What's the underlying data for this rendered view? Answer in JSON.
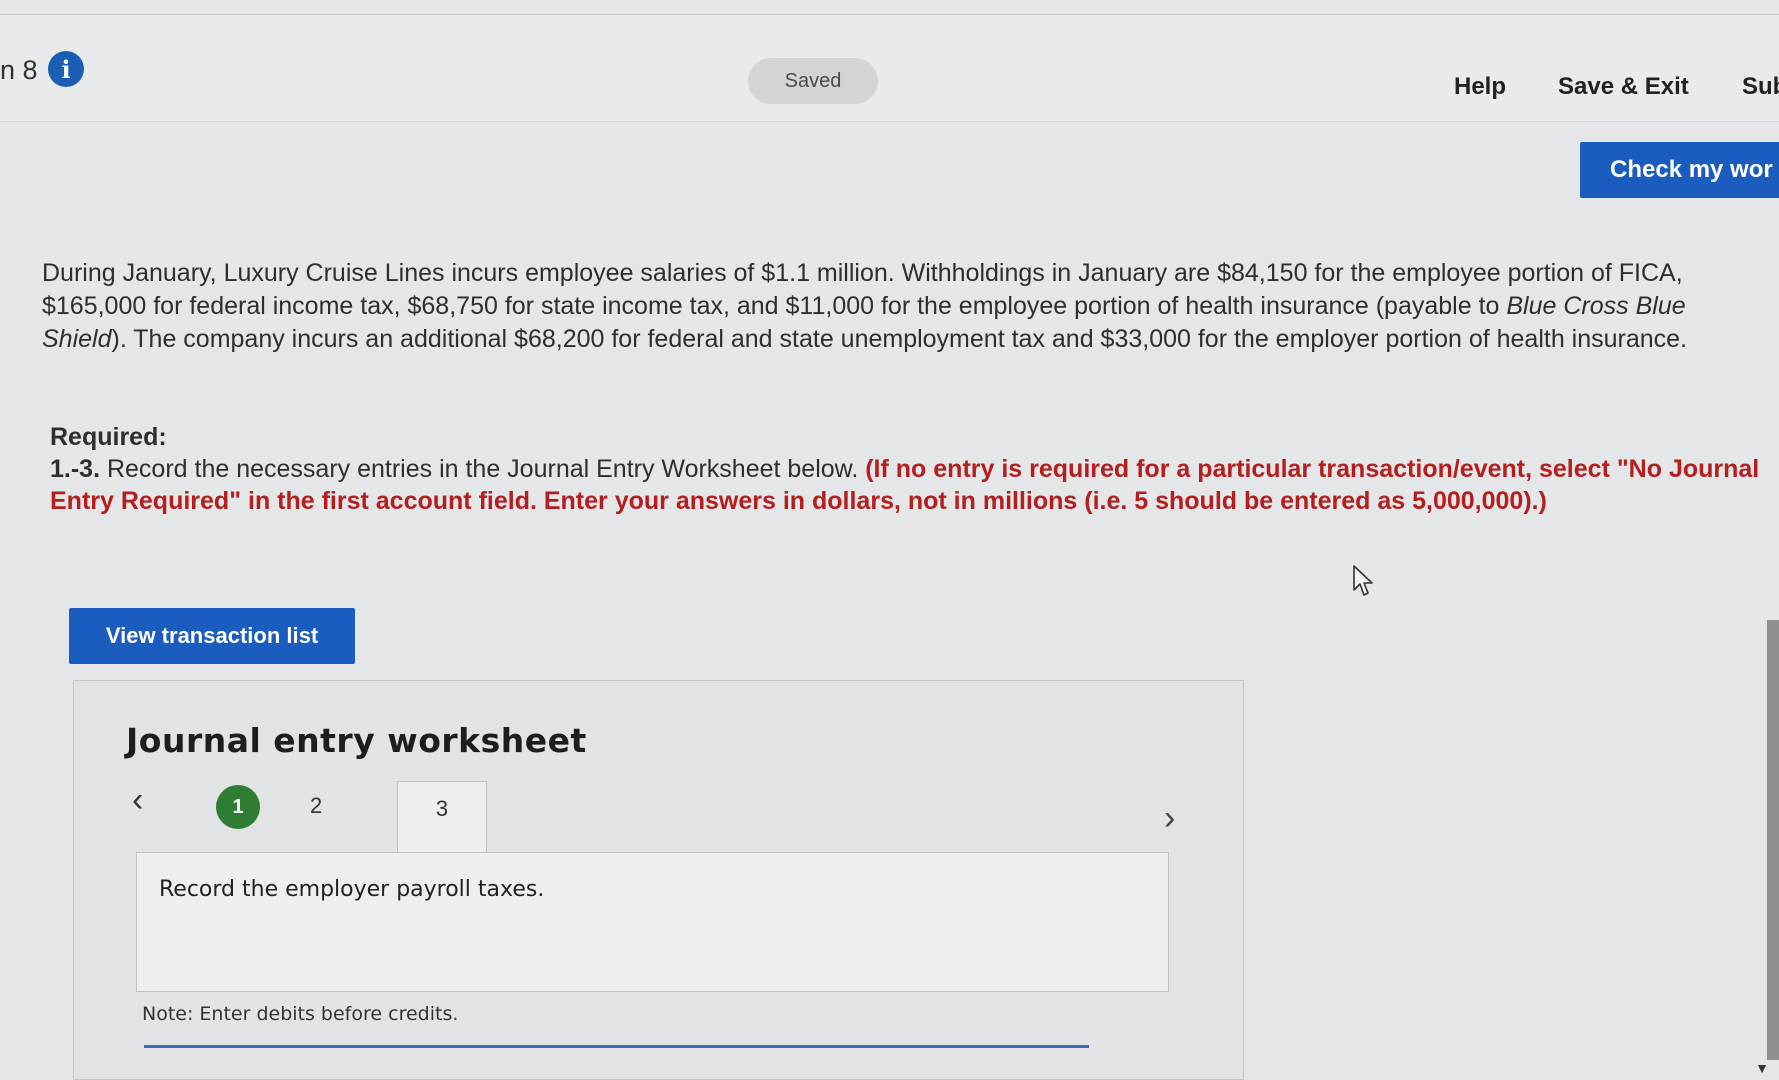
{
  "header": {
    "question_number": "n 8",
    "saved_label": "Saved",
    "help_label": "Help",
    "save_exit_label": "Save & Exit",
    "submit_label": "Sub"
  },
  "check_button_label": "Check my wor",
  "problem": {
    "text_before": "During January, Luxury Cruise Lines incurs employee salaries of $1.1 million. Withholdings in January are $84,150 for the employee portion of FICA, $165,000 for federal income tax, $68,750 for state income tax, and $11,000 for the employee portion of health insurance (payable to ",
    "italic": "Blue Cross Blue Shield",
    "text_after": "). The company incurs an additional $68,200 for federal and state unemployment tax and $33,000 for the employer portion of health insurance."
  },
  "required": {
    "heading": "Required:",
    "number": "1.-3.",
    "text": " Record the necessary entries in the Journal Entry Worksheet below. ",
    "instruction": "(If no entry is required for a particular transaction/event, select \"No Journal Entry Required\" in the first account field. Enter your answers in dollars, not in millions (i.e. 5 should be entered as 5,000,000).)"
  },
  "view_transaction_label": "View transaction list",
  "worksheet": {
    "title": "Journal entry worksheet",
    "steps": [
      "1",
      "2",
      "3"
    ],
    "description": "Record the employer payroll taxes.",
    "note": "Note: Enter debits before credits."
  },
  "colors": {
    "primary_button": "#1b5cbf",
    "completed_step": "#2e7d32",
    "instruction_red": "#b41e1e"
  }
}
